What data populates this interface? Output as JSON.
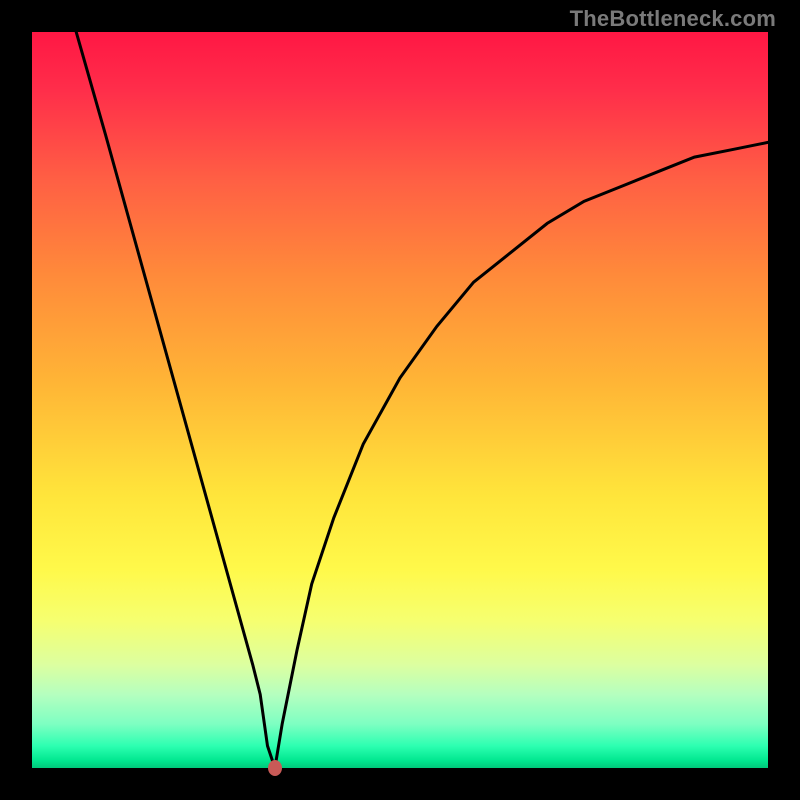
{
  "watermark": "TheBottleneck.com",
  "chart_data": {
    "type": "line",
    "title": "",
    "xlabel": "",
    "ylabel": "",
    "xlim": [
      0,
      100
    ],
    "ylim": [
      0,
      100
    ],
    "grid": false,
    "legend": false,
    "series": [
      {
        "name": "left-branch",
        "x": [
          6,
          10,
          15,
          20,
          25,
          30,
          31,
          32,
          33
        ],
        "y": [
          100,
          86,
          68,
          50,
          32,
          14,
          10,
          3,
          0
        ]
      },
      {
        "name": "right-branch",
        "x": [
          33,
          34,
          36,
          38,
          41,
          45,
          50,
          55,
          60,
          65,
          70,
          75,
          80,
          85,
          90,
          95,
          100
        ],
        "y": [
          0,
          6,
          16,
          25,
          34,
          44,
          53,
          60,
          66,
          70,
          74,
          77,
          79,
          81,
          83,
          84,
          85
        ]
      }
    ],
    "marker": {
      "x": 33,
      "y": 0,
      "color": "#c85a57"
    },
    "background_gradient": {
      "type": "vertical",
      "stops": [
        {
          "pos": 0,
          "color": "#ff1744"
        },
        {
          "pos": 50,
          "color": "#ffc83a"
        },
        {
          "pos": 75,
          "color": "#fff94a"
        },
        {
          "pos": 100,
          "color": "#00c97b"
        }
      ]
    }
  }
}
